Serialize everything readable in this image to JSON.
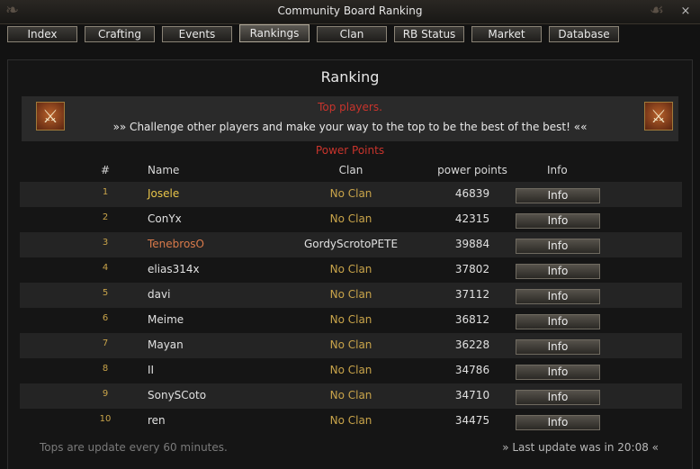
{
  "window": {
    "title": "Community Board Ranking",
    "close_glyph": "×"
  },
  "tabs": [
    {
      "label": "Index",
      "active": false
    },
    {
      "label": "Crafting",
      "active": false
    },
    {
      "label": "Events",
      "active": false
    },
    {
      "label": "Rankings",
      "active": true
    },
    {
      "label": "Clan",
      "active": false
    },
    {
      "label": "RB Status",
      "active": false
    },
    {
      "label": "Market",
      "active": false
    },
    {
      "label": "Database",
      "active": false
    }
  ],
  "page": {
    "heading": "Ranking",
    "banner_title": "Top players.",
    "banner_text": "»» Challenge other players and make your way to the top to be the best of the best! ««",
    "banner_icon": "crossed-swords-icon",
    "section_title": "Power Points"
  },
  "table": {
    "columns": {
      "num": "#",
      "name": "Name",
      "clan": "Clan",
      "points": "power points",
      "info": "Info"
    },
    "rows": [
      {
        "num": "1",
        "name": "Josele",
        "clan": "No Clan",
        "points": "46839",
        "info": "Info"
      },
      {
        "num": "2",
        "name": "ConYx",
        "clan": "No Clan",
        "points": "42315",
        "info": "Info"
      },
      {
        "num": "3",
        "name": "TenebrosO",
        "clan": "GordyScrotoPETE",
        "points": "39884",
        "info": "Info"
      },
      {
        "num": "4",
        "name": "elias314x",
        "clan": "No Clan",
        "points": "37802",
        "info": "Info"
      },
      {
        "num": "5",
        "name": "davi",
        "clan": "No Clan",
        "points": "37112",
        "info": "Info"
      },
      {
        "num": "6",
        "name": "Meime",
        "clan": "No Clan",
        "points": "36812",
        "info": "Info"
      },
      {
        "num": "7",
        "name": "Mayan",
        "clan": "No Clan",
        "points": "36228",
        "info": "Info"
      },
      {
        "num": "8",
        "name": "II",
        "clan": "No Clan",
        "points": "34786",
        "info": "Info"
      },
      {
        "num": "9",
        "name": "SonySCoto",
        "clan": "No Clan",
        "points": "34710",
        "info": "Info"
      },
      {
        "num": "10",
        "name": "ren",
        "clan": "No Clan",
        "points": "34475",
        "info": "Info"
      }
    ]
  },
  "footer": {
    "left": "Tops are update every 60 minutes.",
    "right": "» Last update was in 20:08 «"
  },
  "colors": {
    "accent_red": "#c8342c",
    "gold": "#c9a44a",
    "rank1_name": "#e8c54a",
    "rank3_name": "#d97a4a"
  }
}
